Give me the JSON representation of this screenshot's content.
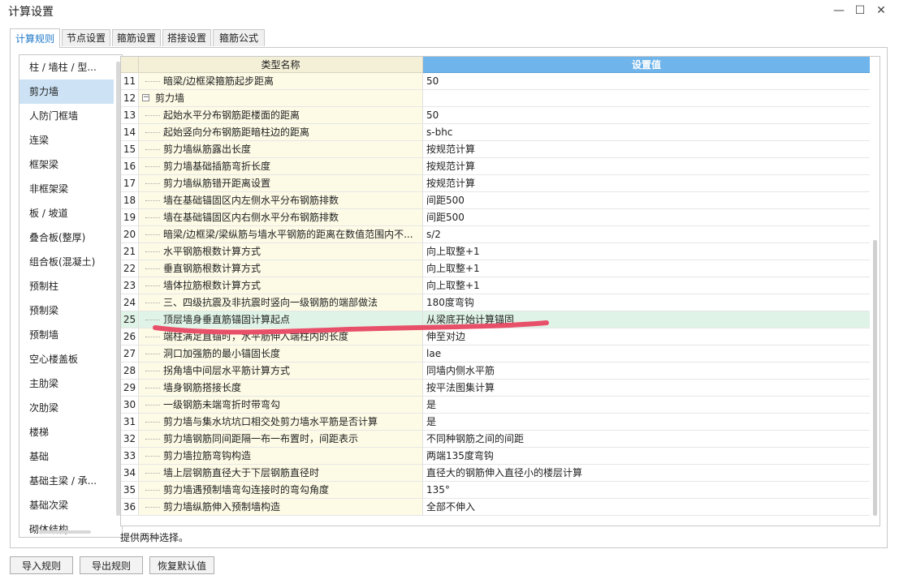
{
  "window": {
    "title": "计算设置"
  },
  "tabs": [
    {
      "label": "计算规则",
      "active": true
    },
    {
      "label": "节点设置",
      "active": false
    },
    {
      "label": "箍筋设置",
      "active": false
    },
    {
      "label": "搭接设置",
      "active": false
    },
    {
      "label": "箍筋公式",
      "active": false
    }
  ],
  "sidebar": {
    "selected": "剪力墙",
    "items": [
      "柱 / 墙柱 / 型...",
      "剪力墙",
      "人防门框墙",
      "连梁",
      "框架梁",
      "非框架梁",
      "板 / 坡道",
      "叠合板(整厚)",
      "组合板(混凝土)",
      "预制柱",
      "预制梁",
      "预制墙",
      "空心楼盖板",
      "主肋梁",
      "次肋梁",
      "楼梯",
      "基础",
      "基础主梁 / 承...",
      "基础次梁",
      "砌体结构"
    ]
  },
  "grid": {
    "headers": {
      "name": "类型名称",
      "value": "设置值"
    },
    "rows": [
      {
        "num": "11",
        "name": "暗梁/边框梁箍筋起步距离",
        "value": "50"
      },
      {
        "num": "12",
        "name": "剪力墙",
        "value": "",
        "group": true
      },
      {
        "num": "13",
        "name": "起始水平分布钢筋距楼面的距离",
        "value": "50"
      },
      {
        "num": "14",
        "name": "起始竖向分布钢筋距暗柱边的距离",
        "value": "s-bhc"
      },
      {
        "num": "15",
        "name": "剪力墙纵筋露出长度",
        "value": "按规范计算"
      },
      {
        "num": "16",
        "name": "剪力墙基础插筋弯折长度",
        "value": "按规范计算"
      },
      {
        "num": "17",
        "name": "剪力墙纵筋错开距离设置",
        "value": "按规范计算"
      },
      {
        "num": "18",
        "name": "墙在基础锚固区内左侧水平分布钢筋排数",
        "value": "间距500"
      },
      {
        "num": "19",
        "name": "墙在基础锚固区内右侧水平分布钢筋排数",
        "value": "间距500"
      },
      {
        "num": "20",
        "name": "暗梁/边框梁/梁纵筋与墙水平钢筋的距离在数值范围内不...",
        "value": "s/2"
      },
      {
        "num": "21",
        "name": "水平钢筋根数计算方式",
        "value": "向上取整+1"
      },
      {
        "num": "22",
        "name": "垂直钢筋根数计算方式",
        "value": "向上取整+1"
      },
      {
        "num": "23",
        "name": "墙体拉筋根数计算方式",
        "value": "向上取整+1"
      },
      {
        "num": "24",
        "name": "三、四级抗震及非抗震时竖向一级钢筋的端部做法",
        "value": "180度弯钩"
      },
      {
        "num": "25",
        "name": "顶层墙身垂直筋锚固计算起点",
        "value": "从梁底开始计算锚固",
        "selected": true
      },
      {
        "num": "26",
        "name": "端柱满足直锚时，水平筋伸入端柱内的长度",
        "value": "伸至对边"
      },
      {
        "num": "27",
        "name": "洞口加强筋的最小锚固长度",
        "value": "lae"
      },
      {
        "num": "28",
        "name": "拐角墙中间层水平筋计算方式",
        "value": "同墙内侧水平筋"
      },
      {
        "num": "29",
        "name": "墙身钢筋搭接长度",
        "value": "按平法图集计算"
      },
      {
        "num": "30",
        "name": "一级钢筋未端弯折时带弯勾",
        "value": "是"
      },
      {
        "num": "31",
        "name": "剪力墙与集水坑坑口相交处剪力墙水平筋是否计算",
        "value": "是"
      },
      {
        "num": "32",
        "name": "剪力墙钢筋同间距隔一布一布置时，间距表示",
        "value": "不同种钢筋之间的间距"
      },
      {
        "num": "33",
        "name": "剪力墙拉筋弯钩构造",
        "value": "两端135度弯钩"
      },
      {
        "num": "34",
        "name": "墙上层钢筋直径大于下层钢筋直径时",
        "value": "直径大的钢筋伸入直径小的楼层计算"
      },
      {
        "num": "35",
        "name": "剪力墙遇预制墙弯勾连接时的弯勾角度",
        "value": "135°"
      },
      {
        "num": "36",
        "name": "剪力墙纵筋伸入预制墙构造",
        "value": "全部不伸入"
      }
    ]
  },
  "description": "提供两种选择。",
  "buttons": {
    "import": "导入规则",
    "export": "导出规则",
    "restore": "恢复默认值"
  },
  "colors": {
    "header_value_bg": "#6fb4ea",
    "selected_row_bg": "#dff3e6",
    "annotation_stroke": "#e8506a"
  }
}
